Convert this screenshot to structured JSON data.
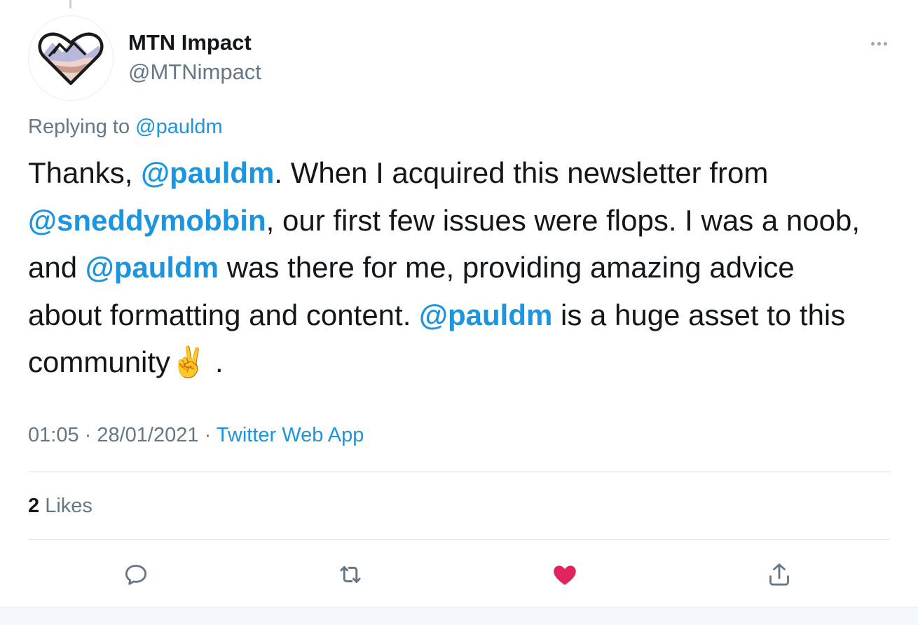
{
  "author": {
    "display_name": "MTN Impact",
    "handle": "@MTNimpact",
    "avatar_icon": "mountain-heart-logo"
  },
  "reply_context": {
    "prefix": "Replying to",
    "mention": "@pauldm"
  },
  "tweet": {
    "segments": [
      {
        "type": "text",
        "value": "Thanks, "
      },
      {
        "type": "mention",
        "value": "@pauldm"
      },
      {
        "type": "text",
        "value": ". When I acquired this newsletter from "
      },
      {
        "type": "mention",
        "value": "@sneddymobbin"
      },
      {
        "type": "text",
        "value": ", our first few issues were flops. I was a noob, and "
      },
      {
        "type": "mention",
        "value": "@pauldm"
      },
      {
        "type": "text",
        "value": " was there for me, providing amazing advice about formatting and content. "
      },
      {
        "type": "mention",
        "value": "@pauldm"
      },
      {
        "type": "text",
        "value": " is a huge asset to this community"
      },
      {
        "type": "emoji",
        "value": "✌️"
      },
      {
        "type": "text",
        "value": " ."
      }
    ]
  },
  "meta": {
    "time": "01:05",
    "separator": " · ",
    "date": "28/01/2021",
    "source": "Twitter Web App"
  },
  "likes": {
    "count": "2",
    "label": "Likes"
  },
  "actions": {
    "reply_icon": "reply-icon",
    "retweet_icon": "retweet-icon",
    "like_icon": "heart-filled-icon",
    "share_icon": "share-icon",
    "like_active": true
  },
  "colors": {
    "link": "#1b95e0",
    "like": "#e0245e",
    "muted": "#657786",
    "icon": "#657786"
  }
}
